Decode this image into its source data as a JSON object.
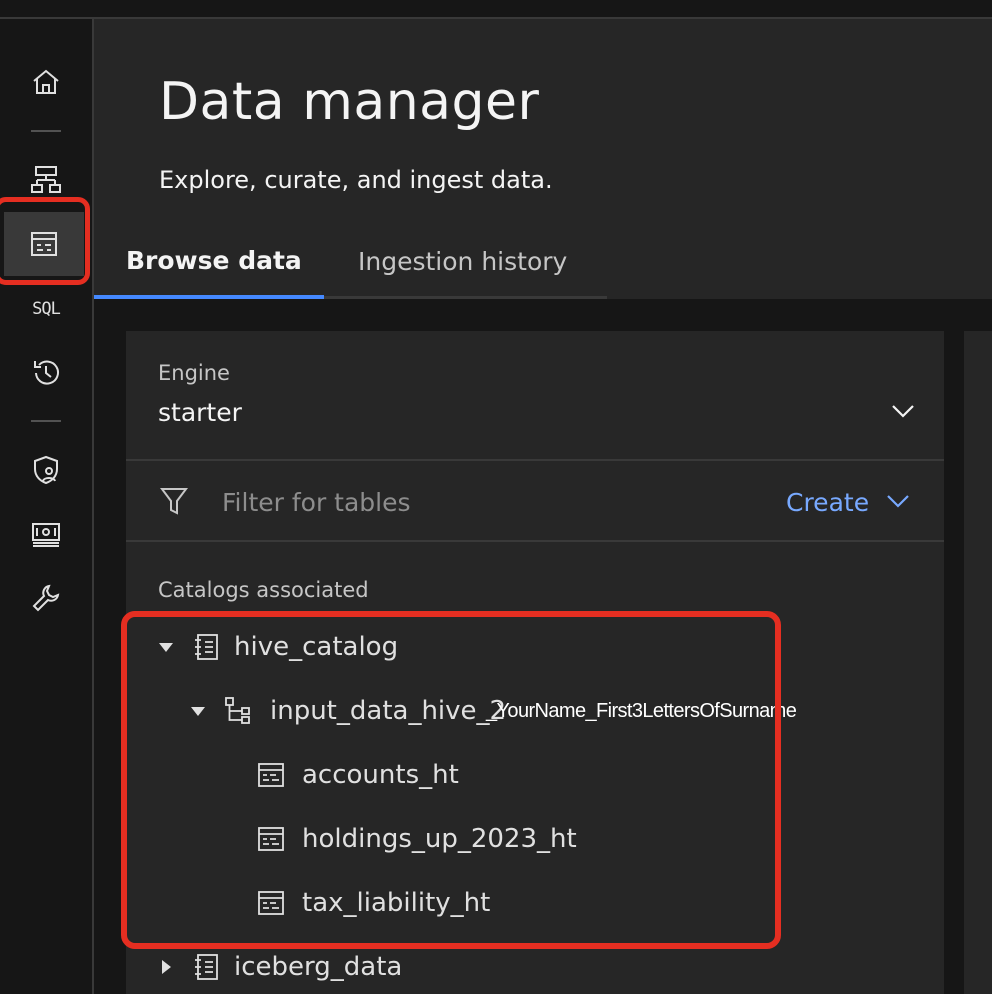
{
  "rail": {
    "items": [
      {
        "name": "home-icon"
      },
      {
        "name": "infrastructure-icon"
      },
      {
        "name": "data-manager-icon",
        "active": true
      },
      {
        "name": "sql-icon",
        "label": "SQL"
      },
      {
        "name": "query-history-icon"
      },
      {
        "name": "access-control-icon"
      },
      {
        "name": "billing-icon"
      },
      {
        "name": "configurations-icon"
      }
    ]
  },
  "page": {
    "title": "Data manager",
    "subtitle": "Explore, curate, and ingest data."
  },
  "tabs": [
    {
      "label": "Browse data",
      "active": true
    },
    {
      "label": "Ingestion history",
      "active": false
    }
  ],
  "engine": {
    "label": "Engine",
    "value": "starter"
  },
  "filter": {
    "placeholder": "Filter for tables"
  },
  "create": {
    "label": "Create"
  },
  "catalogs": {
    "label": "Catalogs associated",
    "catalog1": "hive_catalog",
    "schema1": "input_data_hive_2",
    "tables": [
      "accounts_ht",
      "holdings_up_2023_ht",
      "tax_liability_ht"
    ],
    "catalog2": "iceberg_data"
  },
  "annotation": {
    "overlay_text": "_YourName_First3LettersOfSurname"
  },
  "colors": {
    "accent": "#4589ff",
    "link": "#78a9ff",
    "highlight": "#e52e21",
    "background": "#161616",
    "panel": "#262626"
  }
}
